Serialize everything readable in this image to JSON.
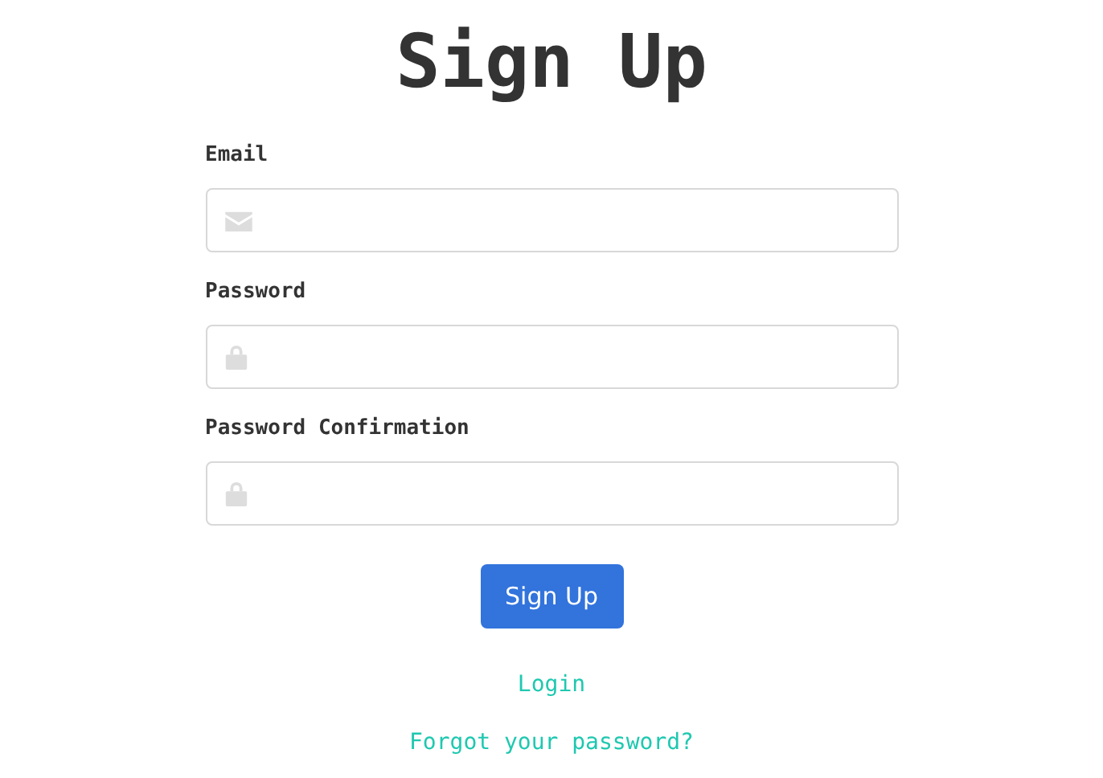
{
  "title": "Sign Up",
  "fields": [
    {
      "label": "Email",
      "kind": "email"
    },
    {
      "label": "Password",
      "kind": "password"
    },
    {
      "label": "Password Confirmation",
      "kind": "password"
    }
  ],
  "submit": "Sign Up",
  "links": [
    "Login",
    "Forgot your password?"
  ]
}
